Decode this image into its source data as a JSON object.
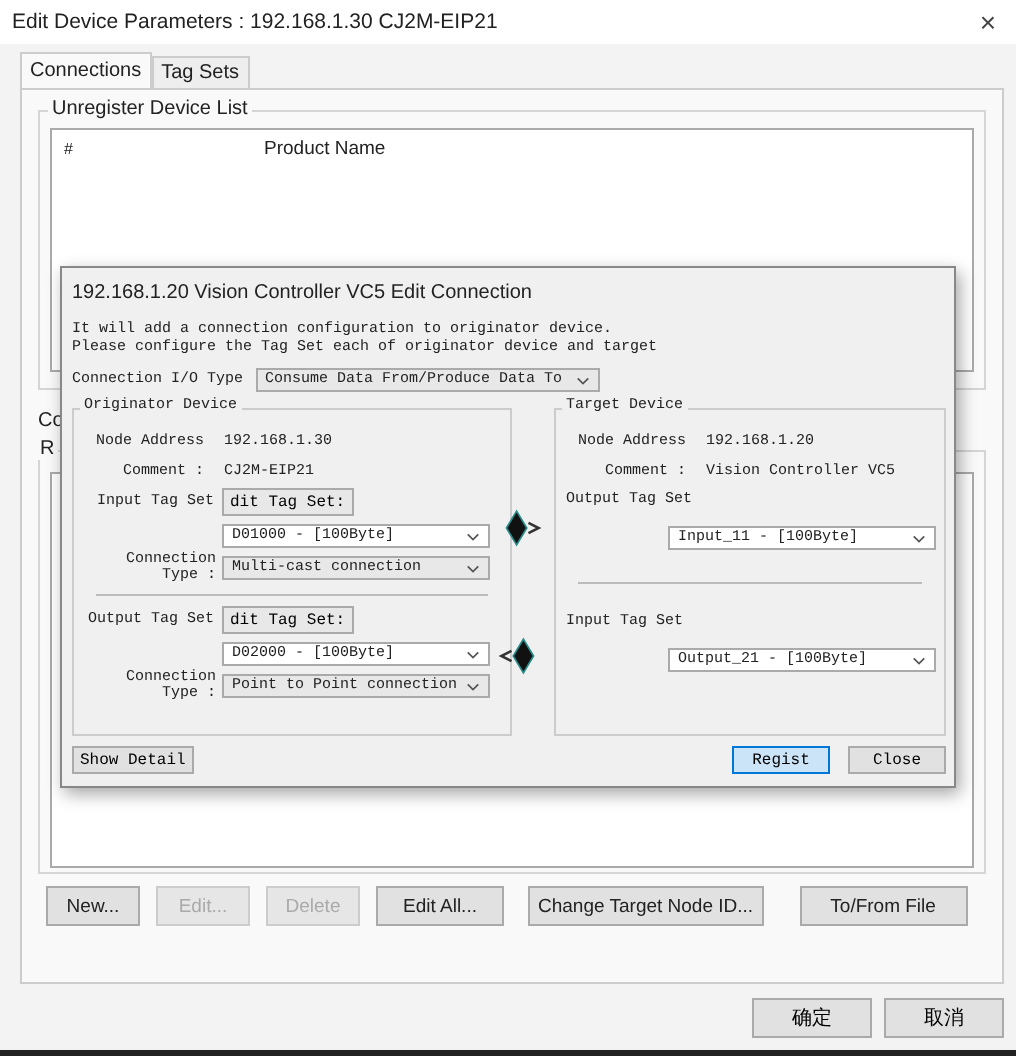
{
  "window": {
    "title": "Edit Device Parameters : 192.168.1.30 CJ2M-EIP21",
    "close": "×"
  },
  "tabs": [
    {
      "label": "Connections",
      "selected": true
    },
    {
      "label": "Tag Sets",
      "selected": false
    }
  ],
  "unregister_list": {
    "legend": "Unregister Device List",
    "columns": [
      "#",
      "Product Name"
    ]
  },
  "partial_labels": [
    "Co",
    "R"
  ],
  "actions": [
    {
      "label": "New...",
      "disabled": false
    },
    {
      "label": "Edit...",
      "disabled": true
    },
    {
      "label": "Delete",
      "disabled": true
    },
    {
      "label": "Edit All...",
      "disabled": false
    },
    {
      "label": "Change Target Node ID...",
      "disabled": false
    },
    {
      "label": "To/From File",
      "disabled": false
    }
  ],
  "footer_buttons": [
    "确定",
    "取消"
  ],
  "dialog": {
    "title": "192.168.1.20 Vision Controller VC5 Edit Connection",
    "description": [
      "It will add a connection configuration to originator device.",
      "Please configure the Tag Set each of originator device and target"
    ],
    "io_type": {
      "label": "Connection I/O Type",
      "value": "Consume Data From/Produce Data To"
    },
    "originator": {
      "legend": "Originator Device",
      "node_address_label": "Node Address",
      "node_address": "192.168.1.30",
      "comment_label": "Comment :",
      "comment": "CJ2M-EIP21",
      "sections": [
        {
          "label": "Input Tag Set",
          "button": "dit Tag Set:",
          "tag_set": "D01000 - [100Byte]",
          "type_label": "Connection Type :",
          "type": "Multi-cast connection"
        },
        {
          "label": "Output Tag Set",
          "button": "dit Tag Set:",
          "tag_set": "D02000 - [100Byte]",
          "type_label": "Connection Type :",
          "type": "Point to Point connection"
        }
      ]
    },
    "target": {
      "legend": "Target Device",
      "node_address_label": "Node Address",
      "node_address": "192.168.1.20",
      "comment_label": "Comment :",
      "comment": "Vision Controller VC5",
      "sections": [
        {
          "label": "Output Tag Set",
          "tag_set": "Input_11 - [100Byte]"
        },
        {
          "label": "Input Tag Set",
          "tag_set": "Output_21 - [100Byte]"
        }
      ]
    },
    "show_detail": "Show Detail",
    "buttons": [
      {
        "label": "Regist",
        "focused": true
      },
      {
        "label": "Close",
        "focused": false
      }
    ]
  }
}
